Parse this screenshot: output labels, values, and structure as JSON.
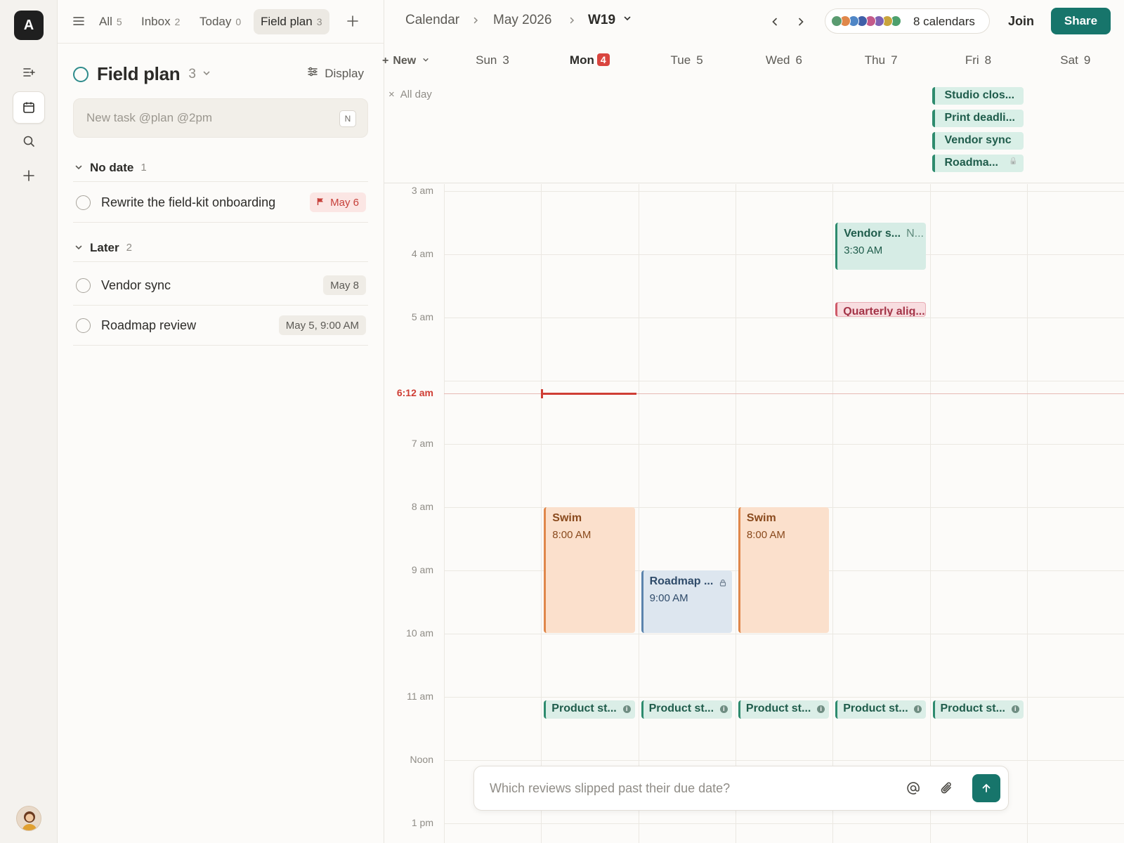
{
  "rail": {
    "logo": "A",
    "icons": [
      "list-add-icon",
      "calendar-icon",
      "search-icon",
      "plus-icon"
    ]
  },
  "tabs": [
    {
      "label": "All",
      "count": "5"
    },
    {
      "label": "Inbox",
      "count": "2"
    },
    {
      "label": "Today",
      "count": "0"
    },
    {
      "label": "Field plan",
      "count": "3",
      "active": true
    }
  ],
  "list": {
    "title": "Field plan",
    "count": "3",
    "display_label": "Display",
    "new_task_placeholder": "New task @plan @2pm",
    "new_task_shortcut": "N",
    "groups": [
      {
        "label": "No date",
        "count": "1",
        "tasks": [
          {
            "title": "Rewrite the field-kit onboarding",
            "chip": "May 6",
            "flagged": true
          }
        ]
      },
      {
        "label": "Later",
        "count": "2",
        "tasks": [
          {
            "title": "Vendor sync",
            "chip": "May 8"
          },
          {
            "title": "Roadmap review",
            "chip": "May 5, 9:00 AM"
          }
        ]
      }
    ]
  },
  "topbar": {
    "crumbs": [
      "Calendar",
      "May 2026",
      "W19"
    ],
    "calendars_label": "8 calendars",
    "calendar_colors": [
      "#5a9b70",
      "#e0874a",
      "#4f86c6",
      "#3f5fa8",
      "#c45a8a",
      "#7e62b3",
      "#c9a43c",
      "#4da06d"
    ],
    "join_label": "Join",
    "share_label": "Share"
  },
  "week": {
    "new_label": "New",
    "allday_label": "All day",
    "days": [
      {
        "name": "Sun",
        "num": "3"
      },
      {
        "name": "Mon",
        "num": "4",
        "today": true
      },
      {
        "name": "Tue",
        "num": "5"
      },
      {
        "name": "Wed",
        "num": "6"
      },
      {
        "name": "Thu",
        "num": "7"
      },
      {
        "name": "Fri",
        "num": "8"
      },
      {
        "name": "Sat",
        "num": "9"
      }
    ],
    "allday_events": [
      {
        "title": "Studio clos...",
        "day": 5
      },
      {
        "title": "Print deadli...",
        "day": 5
      },
      {
        "title": "Vendor sync",
        "day": 5
      },
      {
        "title": "Roadma...",
        "day": 5,
        "locked": true
      }
    ],
    "hours": [
      "3 am",
      "4 am",
      "5 am",
      "6 am",
      "7 am",
      "8 am",
      "9 am",
      "10 am",
      "11 am",
      "Noon",
      "1 pm"
    ],
    "now_label": "6:12 am",
    "events": [
      {
        "title": "Vendor s...",
        "extra": "N...",
        "time": "3:30 AM",
        "day": 4,
        "start": 3.5,
        "end": 4.25,
        "color": "green"
      },
      {
        "title": "Quarterly alig...",
        "day": 4,
        "start": 4.75,
        "end": 5.0,
        "color": "pink"
      },
      {
        "title": "Swim",
        "time": "8:00 AM",
        "day": 1,
        "start": 8,
        "end": 10,
        "color": "orange"
      },
      {
        "title": "Roadmap ...",
        "time": "9:00 AM",
        "day": 2,
        "start": 9,
        "end": 10,
        "color": "blue",
        "locked": true
      },
      {
        "title": "Swim",
        "time": "8:00 AM",
        "day": 3,
        "start": 8,
        "end": 10,
        "color": "orange"
      },
      {
        "title": "Product st...",
        "day": 1,
        "start": 11.05,
        "end": 11.35,
        "color": "gchip",
        "info": true
      },
      {
        "title": "Product st...",
        "day": 2,
        "start": 11.05,
        "end": 11.35,
        "color": "gchip",
        "info": true
      },
      {
        "title": "Product st...",
        "day": 3,
        "start": 11.05,
        "end": 11.35,
        "color": "gchip",
        "info": true
      },
      {
        "title": "Product st...",
        "day": 4,
        "start": 11.05,
        "end": 11.35,
        "color": "gchip",
        "info": true
      },
      {
        "title": "Product st...",
        "day": 5,
        "start": 11.05,
        "end": 11.35,
        "color": "gchip",
        "info": true
      }
    ]
  },
  "ask": {
    "placeholder": "Which reviews slipped past their due date?"
  }
}
